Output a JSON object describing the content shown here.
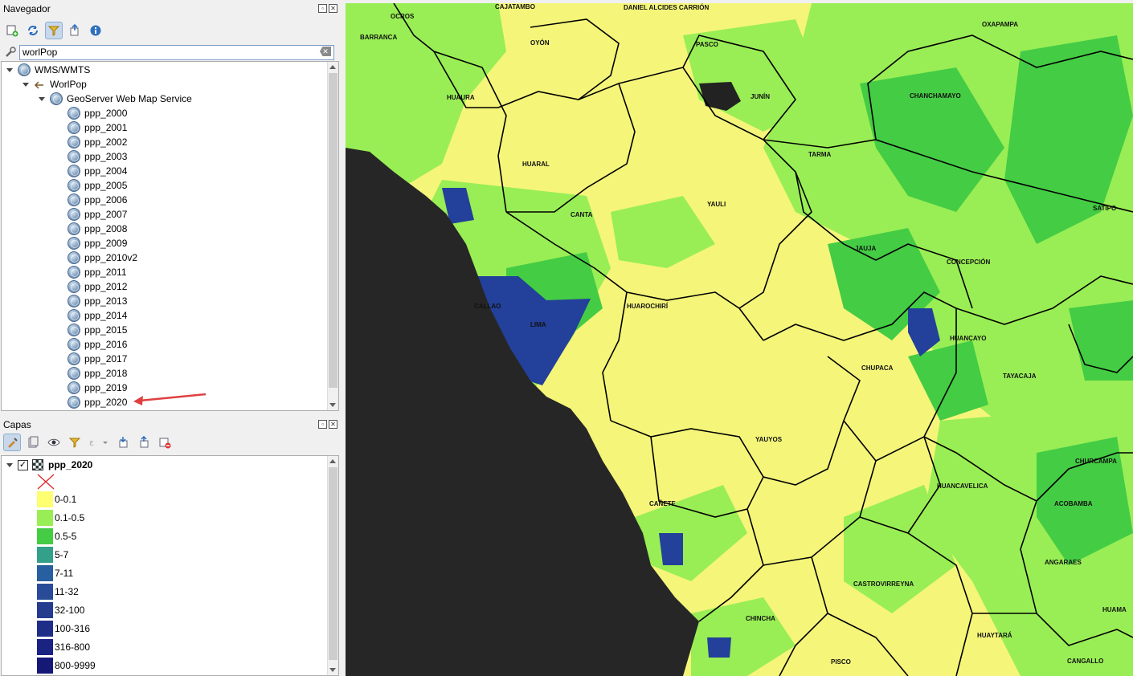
{
  "navegador": {
    "title": "Navegador",
    "search_value": "worlPop",
    "tree": {
      "root": "WMS/WMTS",
      "connection": "WorlPop",
      "service": "GeoServer Web Map Service",
      "layers": [
        "ppp_2000",
        "ppp_2001",
        "ppp_2002",
        "ppp_2003",
        "ppp_2004",
        "ppp_2005",
        "ppp_2006",
        "ppp_2007",
        "ppp_2008",
        "ppp_2009",
        "ppp_2010v2",
        "ppp_2011",
        "ppp_2012",
        "ppp_2013",
        "ppp_2014",
        "ppp_2015",
        "ppp_2016",
        "ppp_2017",
        "ppp_2018",
        "ppp_2019",
        "ppp_2020"
      ]
    }
  },
  "capas": {
    "title": "Capas",
    "layer_name": "ppp_2020",
    "legend": [
      {
        "label": "0-0.1",
        "color": "#ffff72"
      },
      {
        "label": "0.1-0.5",
        "color": "#99ee55"
      },
      {
        "label": "0.5-5",
        "color": "#44cc44"
      },
      {
        "label": "5-7",
        "color": "#33a08a"
      },
      {
        "label": "7-11",
        "color": "#285fa0"
      },
      {
        "label": "11-32",
        "color": "#2a4c98"
      },
      {
        "label": "32-100",
        "color": "#243b90"
      },
      {
        "label": "100-316",
        "color": "#1e2e88"
      },
      {
        "label": "316-800",
        "color": "#1a2282"
      },
      {
        "label": "800-9999",
        "color": "#161878"
      }
    ]
  },
  "map": {
    "labels": [
      "OCROS",
      "CAJATAMBO",
      "DANIEL ALCIDES CARRIÓN",
      "OXAPAMPA",
      "BARRANCA",
      "OYÓN",
      "PASCO",
      "HUAURA",
      "JUNÍN",
      "CHANCHAMAYO",
      "TARMA",
      "HUARAL",
      "YAULI",
      "SATIPO",
      "CANTA",
      "JAUJA",
      "CONCEPCIÓN",
      "CALLAO",
      "HUAROCHIRÍ",
      "LIMA",
      "HUANCAYO",
      "CHUPACA",
      "TAYACAJA",
      "YAUYOS",
      "CHURCAMPA",
      "HUANCAVELICA",
      "CAÑETE",
      "ACOBAMBA",
      "ANGARAES",
      "CASTROVIRREYNA",
      "CHINCHA",
      "HUAYTARÁ",
      "PISCO",
      "CANGALLO",
      "HUAMA"
    ],
    "colors": {
      "ocean": "#262626",
      "low": "#f5f57a",
      "mid": "#99ee55",
      "high": "#44cc44",
      "urban": "#23409a"
    }
  }
}
